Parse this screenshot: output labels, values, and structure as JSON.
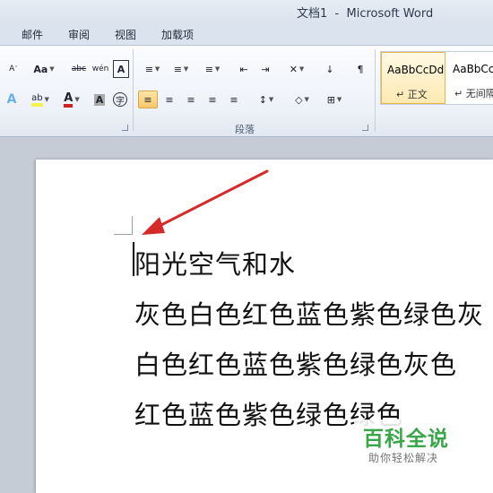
{
  "window": {
    "title": "文档1  -  Microsoft Word"
  },
  "tabs": [
    "邮件",
    "审阅",
    "视图",
    "加载项"
  ],
  "ribbon": {
    "font_group": {
      "row1": [
        "A",
        "Aa",
        "abc",
        "wén",
        "A"
      ],
      "row2": [
        "A",
        "ab",
        "A",
        "A",
        "字"
      ]
    },
    "paragraph_group": {
      "label": "段落",
      "row1": [
        "≡",
        "≡",
        "≡",
        "⇤",
        "⇥",
        "✕",
        "↓",
        "¶"
      ],
      "row2": [
        "≡",
        "≡",
        "≡",
        "≡",
        "≡",
        "↕",
        "◇",
        "⊞"
      ]
    },
    "styles": [
      {
        "sample": "AaBbCcDd",
        "name": "↵ 正文"
      },
      {
        "sample": "AaBbCcDd",
        "name": "↵ 无间隔"
      }
    ]
  },
  "document": {
    "lines": [
      "阳光空气和水",
      "灰色白色红色蓝色紫色绿色灰",
      "白色红色蓝色紫色绿色灰色",
      "红色蓝色紫色绿色绿色"
    ]
  },
  "watermark": {
    "title": "百科全说",
    "subtitle": "助你轻松解决"
  },
  "colors": {
    "accent": "#e8b54b",
    "arrow": "#d42a2a",
    "watermark_green": "#3aa64a"
  }
}
